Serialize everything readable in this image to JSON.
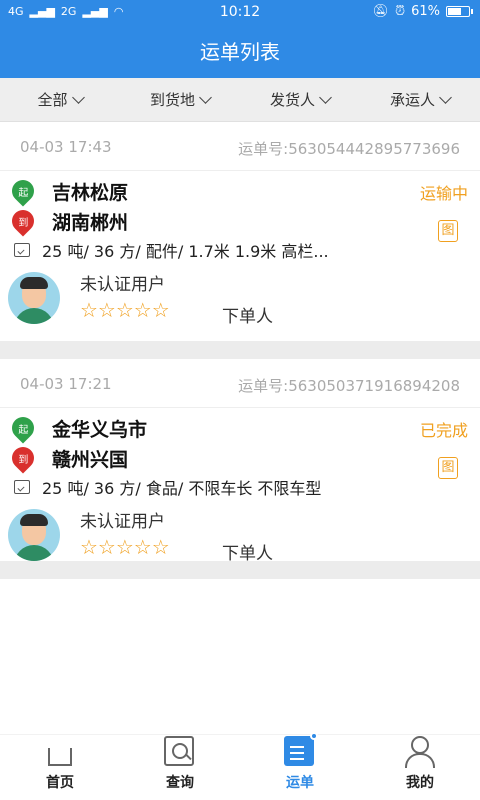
{
  "status_bar": {
    "signal_left": "4G",
    "signal_right": "2G",
    "time": "10:12",
    "battery": "61%",
    "battery_level": 0.61
  },
  "header": {
    "title": "运单列表"
  },
  "filters": [
    {
      "label": "全部"
    },
    {
      "label": "到货地"
    },
    {
      "label": "发货人"
    },
    {
      "label": "承运人"
    }
  ],
  "orders": [
    {
      "date": "04-03 17:43",
      "waybill": "运单号:563054442895773696",
      "start_label": "起",
      "start": "吉林松原",
      "end_label": "到",
      "end": "湖南郴州",
      "status": "运输中",
      "image_label": "图",
      "cargo": "25 吨/ 36 方/ 配件/ 1.7米 1.9米 高栏...",
      "user": "未认证用户",
      "rating": "☆☆☆☆☆",
      "role": "下单人"
    },
    {
      "date": "04-03 17:21",
      "waybill": "运单号:563050371916894208",
      "start_label": "起",
      "start": "金华义乌市",
      "end_label": "到",
      "end": "赣州兴国",
      "status": "已完成",
      "image_label": "图",
      "cargo": "25 吨/ 36 方/ 食品/ 不限车长 不限车型",
      "user": "未认证用户",
      "rating": "☆☆☆☆☆",
      "role": "下单人"
    }
  ],
  "bottom_nav": [
    {
      "label": "首页"
    },
    {
      "label": "查询"
    },
    {
      "label": "运单"
    },
    {
      "label": "我的"
    }
  ],
  "colors": {
    "primary": "#2f8ae5",
    "accent": "#f0a020",
    "start_pin": "#2fa14a",
    "end_pin": "#d9302d"
  }
}
